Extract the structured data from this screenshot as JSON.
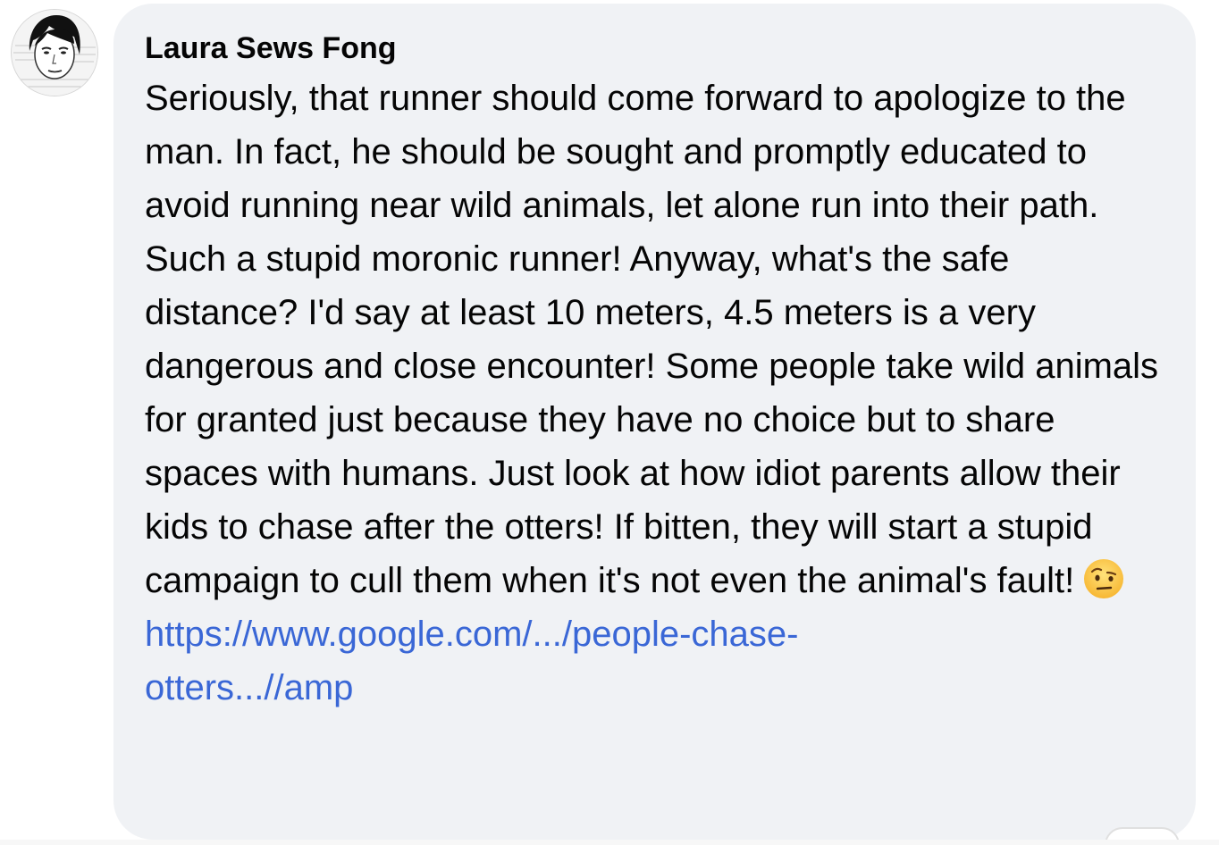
{
  "comment": {
    "author": "Laura Sews Fong",
    "text": "Seriously, that runner should come forward to apologize to the man. In fact, he should be sought and promptly educated to avoid running near wild animals, let alone run into their path. Such a stupid moronic runner! Anyway, what's the safe distance? I'd say at least 10 meters, 4.5 meters is a very dangerous and close encounter! Some people take wild animals for granted just because they have no choice but to share spaces with humans. Just look at how idiot parents allow their kids to chase after the otters! If bitten, they will start a stupid campaign to cull them when it's not even the animal's fault!",
    "emoji_icon": "face-with-raised-eyebrow-icon",
    "link_line1": "https://www.google.com/.../people-chase-",
    "link_line2": "otters...//amp"
  },
  "colors": {
    "bubble_background": "#f0f2f5",
    "text": "#050505",
    "link": "#3a67d6"
  }
}
